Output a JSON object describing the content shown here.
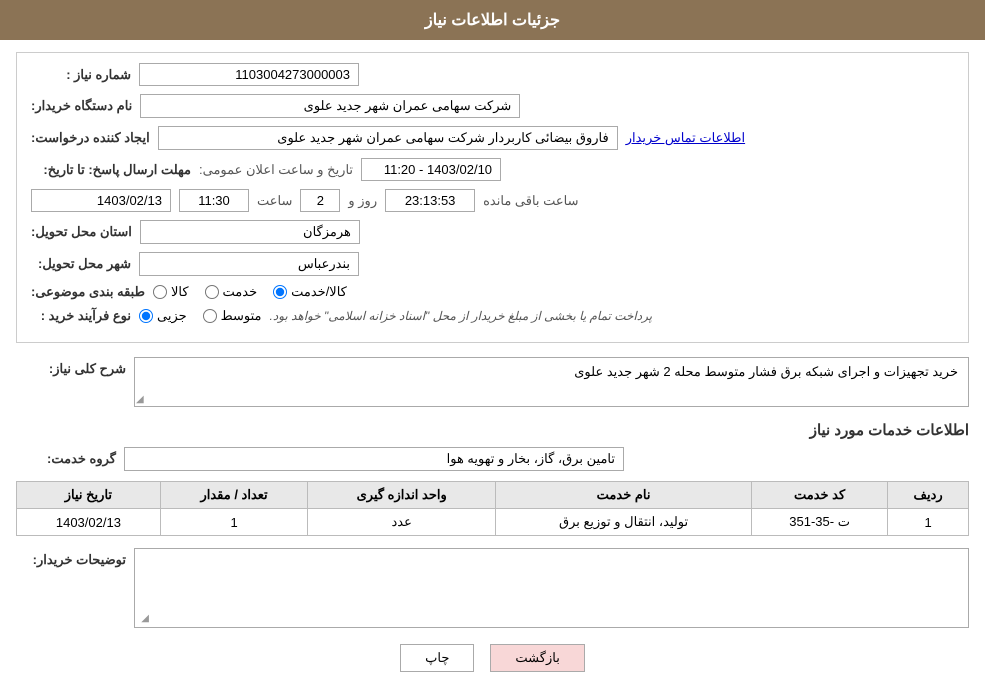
{
  "header": {
    "title": "جزئیات اطلاعات نیاز"
  },
  "fields": {
    "need_number_label": "شماره نیاز :",
    "need_number_value": "1103004273000003",
    "buyer_org_label": "نام دستگاه خریدار:",
    "buyer_org_value": "شرکت سهامی عمران شهر جدید علوی",
    "requester_label": "ایجاد کننده درخواست:",
    "requester_value": "فاروق  بیضائی کاربردار شرکت سهامی عمران شهر جدید علوی",
    "contact_link": "اطلاعات تماس خریدار",
    "announce_datetime_label": "تاریخ و ساعت اعلان عمومی:",
    "announce_datetime_value": "1403/02/10 - 11:20",
    "response_deadline_label": "مهلت ارسال پاسخ: تا تاریخ:",
    "response_date_value": "1403/02/13",
    "response_time_label": "ساعت",
    "response_time_value": "11:30",
    "response_days_label": "روز و",
    "response_days_value": "2",
    "response_timer_value": "23:13:53",
    "response_remaining_label": "ساعت باقی مانده",
    "province_label": "استان محل تحویل:",
    "province_value": "هرمزگان",
    "city_label": "شهر محل تحویل:",
    "city_value": "بندرعباس",
    "category_label": "طبقه بندی موضوعی:",
    "category_options": [
      {
        "label": "کالا",
        "value": "kala",
        "checked": false
      },
      {
        "label": "خدمت",
        "value": "khedmat",
        "checked": false
      },
      {
        "label": "کالا/خدمت",
        "value": "kala_khedmat",
        "checked": true
      }
    ],
    "process_label": "نوع فرآیند خرید :",
    "process_options": [
      {
        "label": "جزیی",
        "value": "jozii",
        "checked": true
      },
      {
        "label": "متوسط",
        "value": "motavaset",
        "checked": false
      }
    ],
    "process_note": "پرداخت تمام یا بخشی از مبلغ خریدار از محل \"اسناد خزانه اسلامی\" خواهد بود.",
    "description_label": "شرح کلی نیاز:",
    "description_value": "خرید تجهیزات و اجرای شبکه برق فشار متوسط محله 2 شهر جدید علوی"
  },
  "services_section": {
    "title": "اطلاعات خدمات مورد نیاز",
    "group_label": "گروه خدمت:",
    "group_value": "تامین برق، گاز، بخار و تهویه هوا",
    "table": {
      "headers": [
        "ردیف",
        "کد خدمت",
        "نام خدمت",
        "واحد اندازه گیری",
        "تعداد / مقدار",
        "تاریخ نیاز"
      ],
      "rows": [
        {
          "row_num": "1",
          "service_code": "ت -35-351",
          "service_name": "تولید، انتقال و توزیع برق",
          "unit": "عدد",
          "quantity": "1",
          "date": "1403/02/13"
        }
      ]
    }
  },
  "buyer_notes": {
    "label": "توضیحات خریدار:",
    "value": ""
  },
  "buttons": {
    "print_label": "چاپ",
    "back_label": "بازگشت"
  }
}
